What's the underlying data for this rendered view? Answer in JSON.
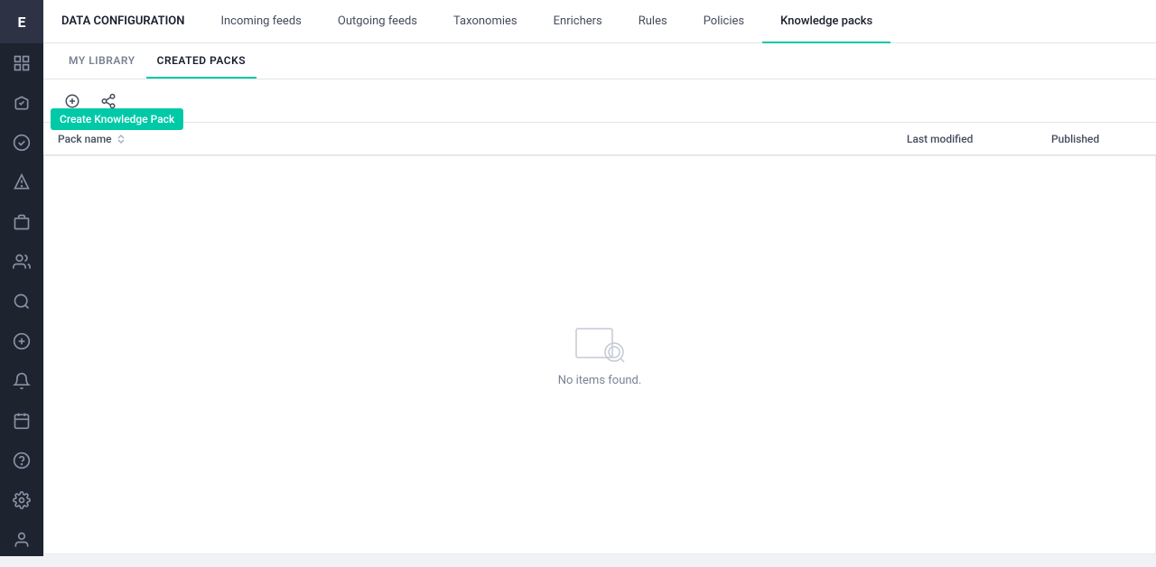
{
  "app": {
    "logo": "E"
  },
  "topnav": {
    "items": [
      {
        "id": "data-config",
        "label": "DATA CONFIGURATION",
        "active": false,
        "first": true
      },
      {
        "id": "incoming-feeds",
        "label": "Incoming feeds",
        "active": false
      },
      {
        "id": "outgoing-feeds",
        "label": "Outgoing feeds",
        "active": false
      },
      {
        "id": "taxonomies",
        "label": "Taxonomies",
        "active": false
      },
      {
        "id": "enrichers",
        "label": "Enrichers",
        "active": false
      },
      {
        "id": "rules",
        "label": "Rules",
        "active": false
      },
      {
        "id": "policies",
        "label": "Policies",
        "active": false
      },
      {
        "id": "knowledge-packs",
        "label": "Knowledge packs",
        "active": true
      }
    ]
  },
  "subnav": {
    "items": [
      {
        "id": "my-library",
        "label": "MY LIBRARY",
        "active": false
      },
      {
        "id": "created-packs",
        "label": "CREATED PACKS",
        "active": true
      }
    ]
  },
  "toolbar": {
    "create_tooltip": "Create Knowledge Pack"
  },
  "table": {
    "columns": {
      "pack_name": "Pack name",
      "last_modified": "Last modified",
      "published": "Published"
    },
    "empty_message": "No items found."
  },
  "sidebar": {
    "icons": [
      {
        "id": "dashboard",
        "label": "dashboard-icon"
      },
      {
        "id": "alert",
        "label": "alert-icon"
      },
      {
        "id": "detection",
        "label": "detection-icon"
      },
      {
        "id": "incident",
        "label": "incident-icon"
      },
      {
        "id": "case",
        "label": "case-icon"
      },
      {
        "id": "integration",
        "label": "integration-icon"
      },
      {
        "id": "search",
        "label": "search-icon"
      },
      {
        "id": "add",
        "label": "add-icon"
      }
    ],
    "bottom_icons": [
      {
        "id": "bell",
        "label": "bell-icon"
      },
      {
        "id": "calendar",
        "label": "calendar-icon"
      },
      {
        "id": "help",
        "label": "help-icon"
      },
      {
        "id": "settings",
        "label": "settings-icon"
      },
      {
        "id": "user",
        "label": "user-icon"
      }
    ]
  }
}
